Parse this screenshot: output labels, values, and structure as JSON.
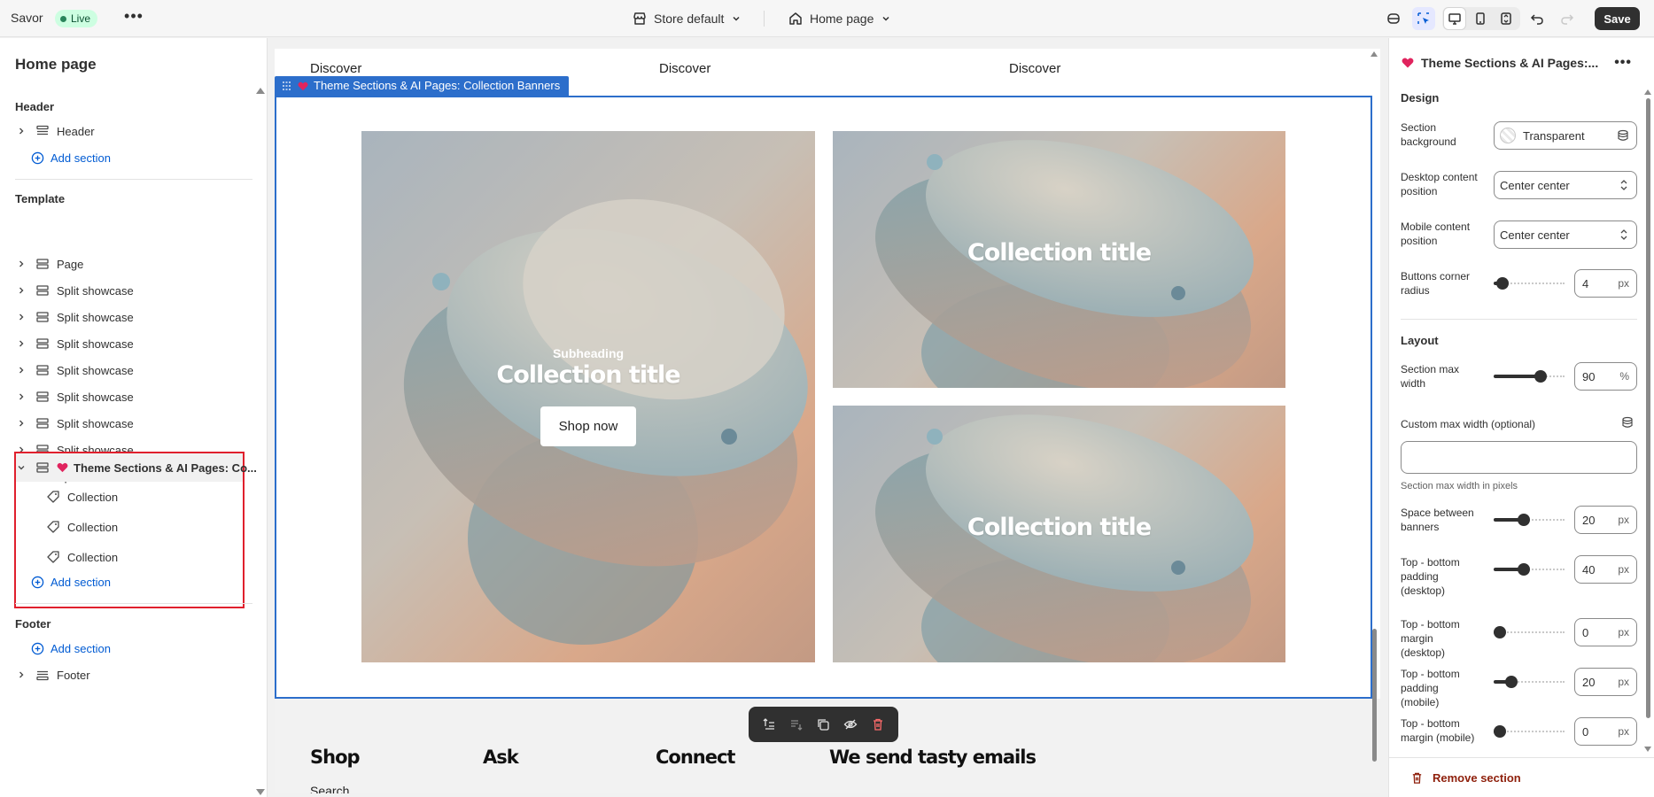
{
  "topbar": {
    "brand": "Savor",
    "live_label": "Live",
    "more_label": "•••",
    "store_picker": "Store default",
    "page_picker": "Home page",
    "save_label": "Save"
  },
  "left_panel": {
    "title": "Home page",
    "header_group": "Header",
    "header_item": "Header",
    "add_section": "Add section",
    "template_group": "Template",
    "template_items": [
      "Page",
      "Split showcase",
      "Split showcase",
      "Split showcase",
      "Split showcase",
      "Split showcase",
      "Split showcase",
      "Split showcase",
      "Split showcase"
    ],
    "selected_section": "Theme Sections & AI Pages: Co...",
    "selected_blocks": [
      "Collection",
      "Collection",
      "Collection"
    ],
    "footer_group": "Footer",
    "footer_item": "Footer"
  },
  "preview": {
    "nav_links": [
      "Discover",
      "Discover",
      "Discover"
    ],
    "section_tag": "Theme Sections & AI Pages: Collection Banners",
    "main_banner": {
      "subheading": "Subheading",
      "title": "Collection title",
      "button": "Shop now"
    },
    "side_banners": [
      "Collection title",
      "Collection title"
    ],
    "footer_heads": [
      "Shop",
      "Ask",
      "Connect",
      "We send tasty emails"
    ],
    "footer_link": "Search"
  },
  "right_panel": {
    "title": "Theme Sections & AI Pages:...",
    "design_heading": "Design",
    "section_background_label": "Section background",
    "section_background_value": "Transparent",
    "desktop_position_label": "Desktop content position",
    "desktop_position_value": "Center center",
    "mobile_position_label": "Mobile content position",
    "mobile_position_value": "Center center",
    "corner_radius_label": "Buttons corner radius",
    "corner_radius_value": "4",
    "layout_heading": "Layout",
    "max_width_label": "Section max width",
    "max_width_value": "90",
    "max_width_unit": "%",
    "custom_max_width_label": "Custom max width (optional)",
    "custom_max_width_help": "Section max width in pixels",
    "space_between_label": "Space between banners",
    "space_between_value": "20",
    "tb_padding_desktop_label": "Top - bottom padding (desktop)",
    "tb_padding_desktop_value": "40",
    "tb_margin_desktop_label": "Top - bottom margin (desktop)",
    "tb_margin_desktop_value": "0",
    "tb_padding_mobile_label": "Top - bottom padding (mobile)",
    "tb_padding_mobile_value": "20",
    "tb_margin_mobile_label": "Top - bottom margin (mobile)",
    "tb_margin_mobile_value": "0",
    "px_unit": "px",
    "remove_label": "Remove section"
  },
  "colors": {
    "accent": "#2c6ecb",
    "link": "#005bd3",
    "selection": "#e0202d",
    "danger": "#8e1f0b",
    "live_bg": "#cdfee1"
  }
}
